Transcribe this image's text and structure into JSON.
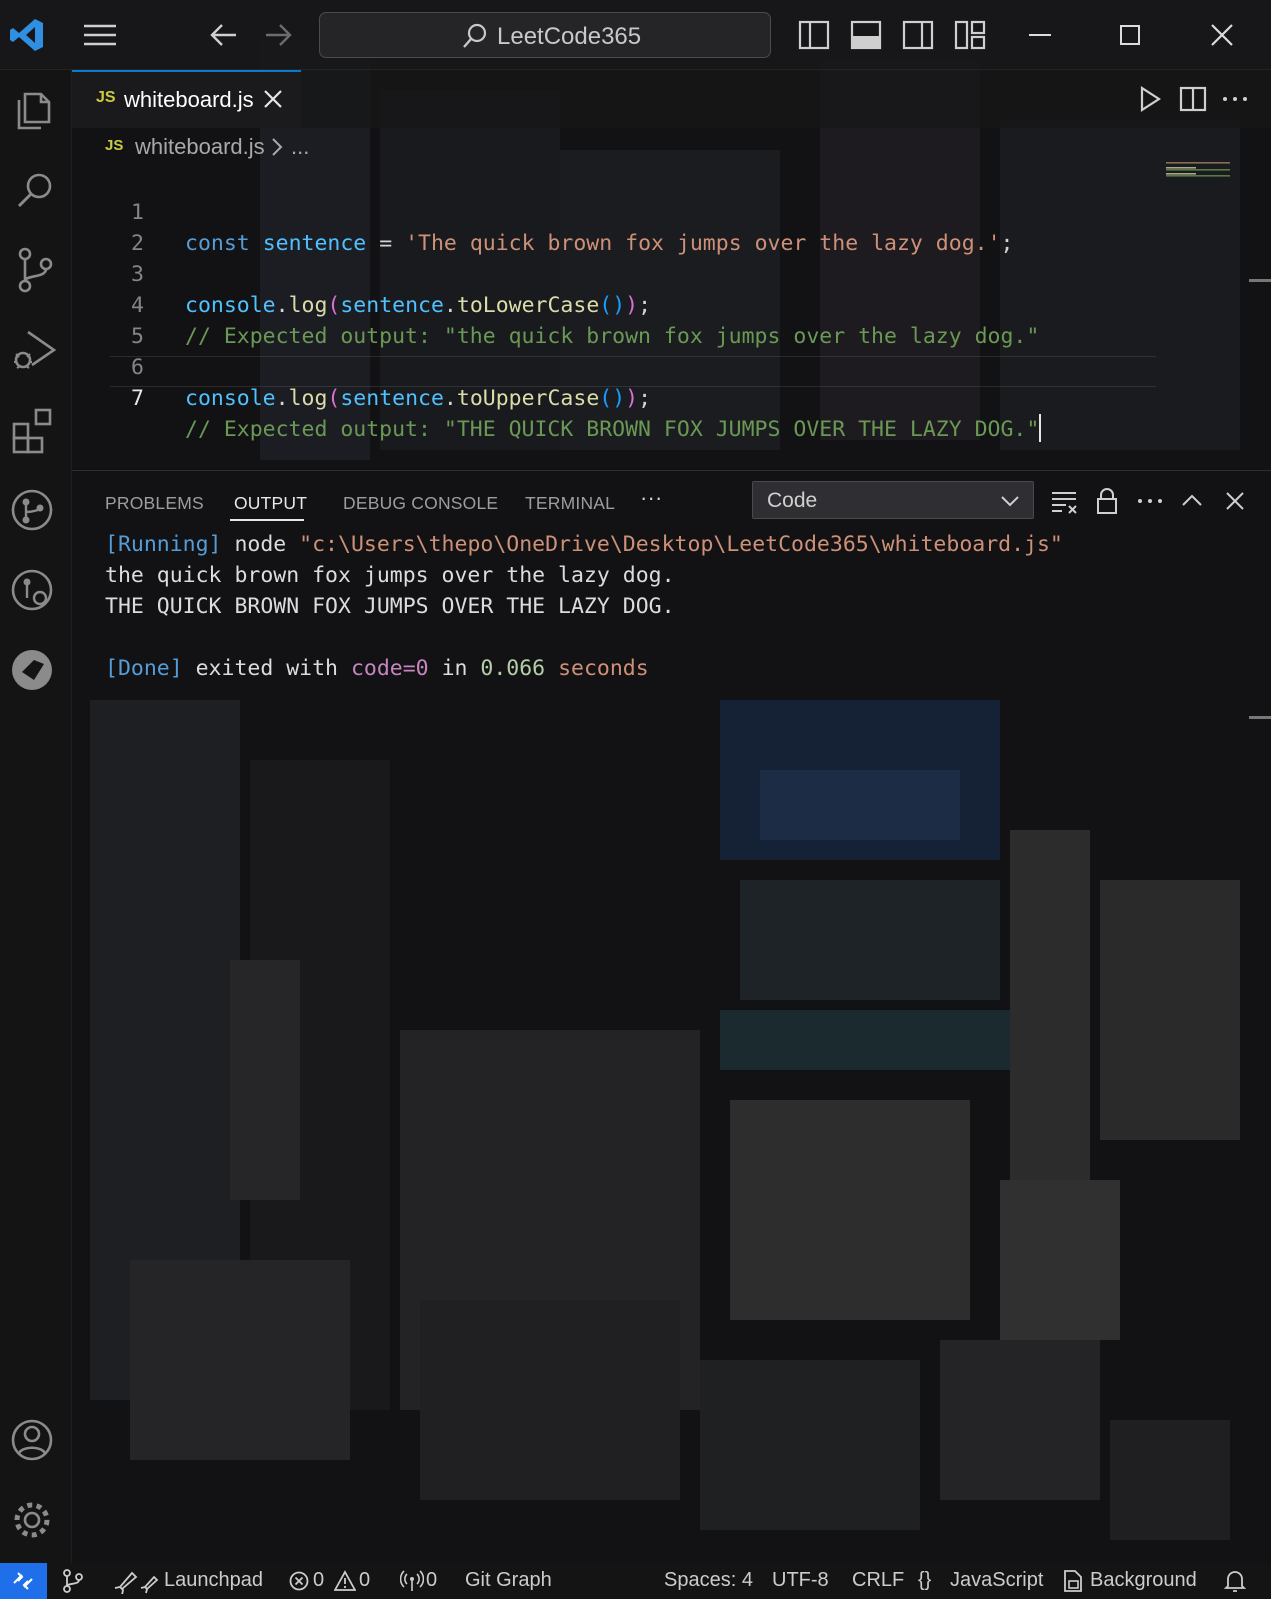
{
  "titlebar": {
    "search_text": "LeetCode365"
  },
  "tab": {
    "lang_badge": "JS",
    "file_name": "whiteboard.js"
  },
  "breadcrumb": {
    "lang_badge": "JS",
    "file_name": "whiteboard.js",
    "ellipsis": "..."
  },
  "editor": {
    "lines": [
      {
        "number": "1"
      },
      {
        "number": "2"
      },
      {
        "number": "3"
      },
      {
        "number": "4"
      },
      {
        "number": "5"
      },
      {
        "number": "6"
      },
      {
        "number": "7"
      }
    ],
    "code": {
      "l1_const": "const",
      "l1_name": "sentence",
      "l1_eq": " = ",
      "l1_str": "'The quick brown fox jumps over the lazy dog.'",
      "l1_semi": ";",
      "l3_obj": "console",
      "l3_dot1": ".",
      "l3_log": "log",
      "l3_p1": "(",
      "l3_arg": "sentence",
      "l3_dot2": ".",
      "l3_method": "toLowerCase",
      "l3_p2": "()",
      "l3_p3": ")",
      "l3_semi": ";",
      "l4_comment": "// Expected output: \"the quick brown fox jumps over the lazy dog.\"",
      "l6_obj": "console",
      "l6_dot1": ".",
      "l6_log": "log",
      "l6_p1": "(",
      "l6_arg": "sentence",
      "l6_dot2": ".",
      "l6_method": "toUpperCase",
      "l6_p2": "()",
      "l6_p3": ")",
      "l6_semi": ";",
      "l7_comment": "// Expected output: \"THE QUICK BROWN FOX JUMPS OVER THE LAZY DOG.\""
    }
  },
  "panel": {
    "tabs": [
      "PROBLEMS",
      "OUTPUT",
      "DEBUG CONSOLE",
      "TERMINAL"
    ],
    "more": "···",
    "channel": "Code",
    "output": {
      "running_tag": "[Running]",
      "running_cmd": " node ",
      "running_path": "\"c:\\Users\\thepo\\OneDrive\\Desktop\\LeetCode365\\whiteboard.js\"",
      "line2": "the quick brown fox jumps over the lazy dog.",
      "line3": "THE QUICK BROWN FOX JUMPS OVER THE LAZY DOG.",
      "done_tag": "[Done]",
      "done_text1": " exited with ",
      "done_code": "code=0",
      "done_text2": " in ",
      "done_time": "0.066",
      "done_text3": " seconds"
    }
  },
  "statusbar": {
    "launchpad": "Launchpad",
    "errors": "0",
    "warnings": "0",
    "ports": "0",
    "git_graph": "Git Graph",
    "spaces": "Spaces: 4",
    "encoding": "UTF-8",
    "eol": "CRLF",
    "language_braces": "{}",
    "language": "JavaScript",
    "background": "Background"
  },
  "colors": {
    "accent": "#0a7acc",
    "remote": "#1f6feb",
    "js_badge": "#cbcb41"
  },
  "icons": [
    "vscode-logo-icon",
    "menu-icon",
    "back-arrow-icon",
    "forward-arrow-icon",
    "search-icon",
    "toggle-primary-sidebar-icon",
    "toggle-panel-icon",
    "toggle-secondary-sidebar-icon",
    "customize-layout-icon",
    "minimize-icon",
    "maximize-icon",
    "close-window-icon",
    "explorer-icon",
    "search-view-icon",
    "source-control-icon",
    "run-debug-icon",
    "extensions-icon",
    "git-graph-icon",
    "gitlens-icon",
    "live-share-icon",
    "account-icon",
    "settings-gear-icon",
    "run-file-icon",
    "split-editor-icon",
    "more-actions-icon",
    "clear-output-icon",
    "lock-icon",
    "maximize-panel-icon",
    "close-panel-icon",
    "remote-icon",
    "branch-icon",
    "rocket-icon",
    "error-icon",
    "warning-icon",
    "broadcast-icon",
    "bell-icon"
  ]
}
